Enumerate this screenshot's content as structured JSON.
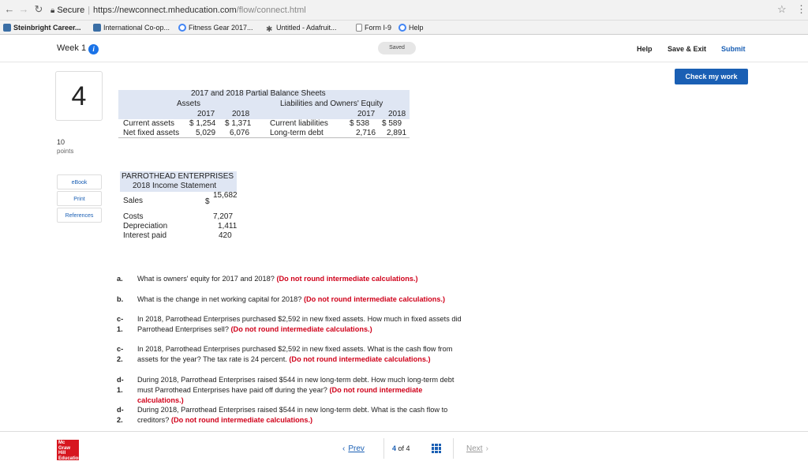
{
  "browser": {
    "secure_label": "Secure",
    "url_main": "https://newconnect.mheducation.com",
    "url_path": "/flow/connect.html",
    "bookmarks": [
      "Steinbright Career...",
      "International Co-op...",
      "Fitness Gear 2017...",
      "Untitled - Adafruit...",
      "Form I-9",
      "Help"
    ]
  },
  "header": {
    "week": "Week 1",
    "saved": "Saved",
    "help": "Help",
    "save_exit": "Save & Exit",
    "submit": "Submit"
  },
  "question": {
    "number": "4",
    "points_value": "10",
    "points_label": "points",
    "side_buttons": [
      "eBook",
      "Print",
      "References"
    ],
    "check_button": "Check my work"
  },
  "balance_sheet": {
    "title": "2017 and 2018 Partial Balance Sheets",
    "assets_header": "Assets",
    "liab_header": "Liabilities and Owners' Equity",
    "years": [
      "2017",
      "2018"
    ],
    "rows": [
      {
        "asset": "Current assets",
        "a2017": "$ 1,254",
        "a2018": "$ 1,371",
        "liab": "Current liabilities",
        "l2017": "$ 538",
        "l2018": "$ 589"
      },
      {
        "asset": "Net fixed assets",
        "a2017": "5,029",
        "a2018": "6,076",
        "liab": "Long-term debt",
        "l2017": "2,716",
        "l2018": "2,891"
      }
    ]
  },
  "income_statement": {
    "company": "PARROTHEAD ENTERPRISES",
    "title": "2018 Income Statement",
    "sales_label": "Sales",
    "sales_dollar": "$",
    "sales_value": "15,682",
    "items": [
      {
        "label": "Costs",
        "value": "7,207"
      },
      {
        "label": "Depreciation",
        "value": "1,411"
      },
      {
        "label": "Interest paid",
        "value": "420"
      }
    ]
  },
  "questions": [
    {
      "label": "a.",
      "text": "What is owners' equity for 2017 and 2018?",
      "note": "(Do not round intermediate calculations.)"
    },
    {
      "label": "b.",
      "text": "What is the change in net working capital for 2018?",
      "note": "(Do not round intermediate calculations.)"
    },
    {
      "label": "c-1.",
      "text": "In 2018, Parrothead Enterprises purchased $2,592 in new fixed assets. How much in fixed assets did Parrothead Enterprises sell?",
      "note": "(Do not round intermediate calculations.)"
    },
    {
      "label": "c-2.",
      "text": "In 2018, Parrothead Enterprises purchased $2,592 in new fixed assets. What is the cash flow from assets for the year? The tax rate is 24 percent.",
      "note": "(Do not round intermediate calculations.)"
    },
    {
      "label": "d-1.",
      "text": "During 2018, Parrothead Enterprises raised $544 in new long-term debt. How much long-term debt must Parrothead Enterprises have paid off during the year?",
      "note": "(Do not round intermediate calculations.)"
    },
    {
      "label": "d-2.",
      "text": "During 2018, Parrothead Enterprises raised $544 in new long-term debt. What is the cash flow to creditors?",
      "note": "(Do not round intermediate calculations.)"
    }
  ],
  "footer": {
    "logo": "Mc Graw Hill Education",
    "prev": "Prev",
    "page_current": "4",
    "page_of": "of 4",
    "next": "Next"
  },
  "colors": {
    "accent": "#1a5fb4",
    "emphasis_red": "#d0021b",
    "table_shade": "#dfe6f3",
    "logo_red": "#d7161f"
  }
}
